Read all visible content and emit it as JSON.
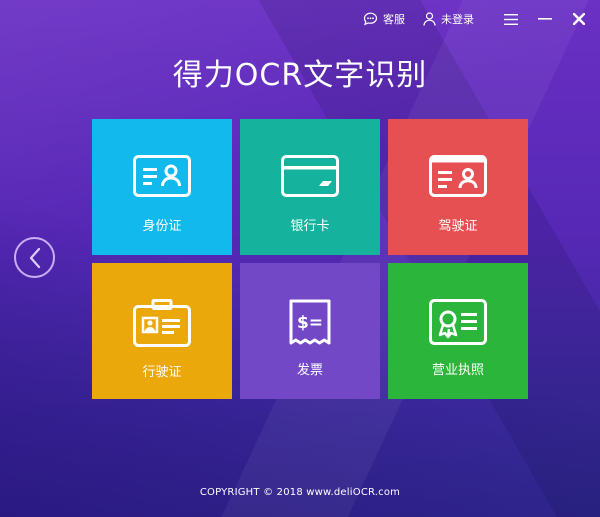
{
  "header": {
    "service_label": "客服",
    "login_label": "未登录"
  },
  "app": {
    "title": "得力OCR文字识别"
  },
  "tiles": [
    {
      "label": "身份证",
      "color": "#11b9ec",
      "icon": "id-card-icon"
    },
    {
      "label": "银行卡",
      "color": "#15b39d",
      "icon": "bank-card-icon"
    },
    {
      "label": "驾驶证",
      "color": "#e75052",
      "icon": "driver-license-icon"
    },
    {
      "label": "行驶证",
      "color": "#eba80b",
      "icon": "vehicle-license-icon"
    },
    {
      "label": "发票",
      "color": "#7348c7",
      "icon": "invoice-icon"
    },
    {
      "label": "营业执照",
      "color": "#2bb63b",
      "icon": "business-license-icon"
    }
  ],
  "footer": {
    "copyright": "COPYRIGHT © 2018  www.deliOCR.com"
  }
}
